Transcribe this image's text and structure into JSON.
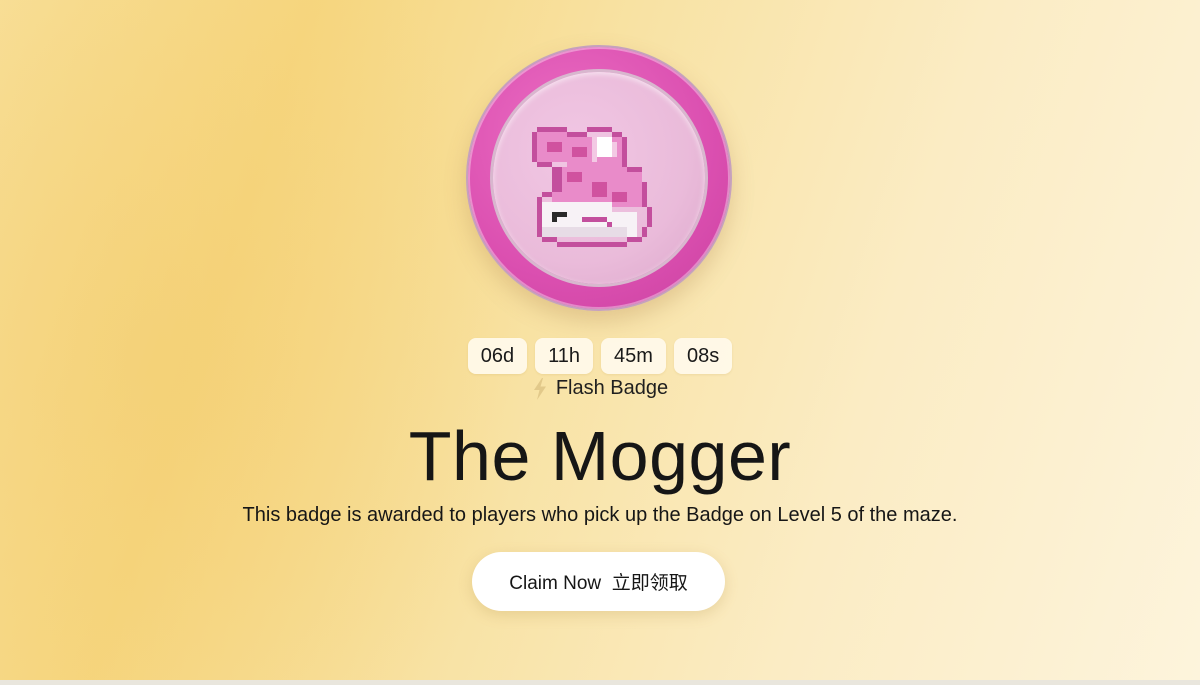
{
  "badge": {
    "icon": "pixel-cat-icon",
    "ring_color": "#db4fb0",
    "inner_color": "#eabbda"
  },
  "countdown": {
    "days": "06d",
    "hours": "11h",
    "minutes": "45m",
    "seconds": "08s"
  },
  "flash": {
    "icon": "lightning-icon",
    "label": "Flash Badge"
  },
  "title": "The Mogger",
  "description": "This badge is awarded to players who pick up the Badge on Level 5 of the maze.",
  "claim_button": {
    "label": "Claim Now  立即领取"
  }
}
